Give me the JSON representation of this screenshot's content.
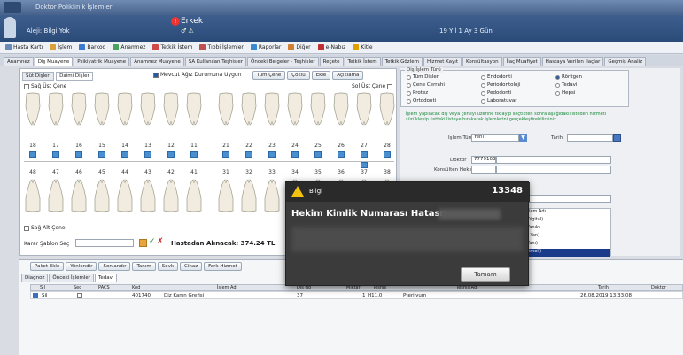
{
  "window": {
    "title": "Doktor Poliklinik İşlemleri"
  },
  "patient": {
    "name": "Erkek",
    "blood_group": "Aleji: Bilgi Yok",
    "age": "19 Yıl 1 Ay 3 Gün"
  },
  "menu": [
    "Hasta Kartı",
    "İşlem",
    "Barkod",
    "Anamnez",
    "Tetkik İstem",
    "Tıbbi İşlemler",
    "Raporlar",
    "Diğer",
    "e-Nabız",
    "Kitle"
  ],
  "menu_icon_colors": [
    "#6a8ab8",
    "#d9a13a",
    "#3a7ad0",
    "#4aa35a",
    "#d04a4a",
    "#c05050",
    "#3a8ad0",
    "#d08030",
    "#c03030",
    "#e0a000"
  ],
  "tabs": [
    "Anamnez",
    "Diş Muayene",
    "Psikiyatrik Muayene",
    "Anamnez Muayene",
    "SA Kullanılan Teşhisler",
    "Önceki Belgeler - Teşhisler",
    "Reçete",
    "Tetkik İstem",
    "Tetkik Gözlem",
    "Hizmet Kayıt",
    "Konsültasyon",
    "İlaç Muafiyet",
    "Hastaya Verilen İlaçlar",
    "Geçmiş Analiz"
  ],
  "left": {
    "subtabs": [
      "Süt Dişleri",
      "Daimi Dişler"
    ],
    "sag_ust": "Sağ Üst Çene",
    "sol_ust": "Sol Üst Çene",
    "mevcut": "Mevcut Ağız Durumuna Uygun",
    "btn_tum": "Tüm Çene",
    "btn_coklu": "Çoklu",
    "btn_ekle": "Ekle",
    "btn_aciklama": "Açıklama",
    "upper_nums": [
      "18",
      "17",
      "16",
      "15",
      "14",
      "13",
      "12",
      "11",
      "21",
      "22",
      "23",
      "24",
      "25",
      "26",
      "27",
      "28"
    ],
    "lower_nums": [
      "48",
      "47",
      "46",
      "45",
      "44",
      "43",
      "42",
      "41",
      "31",
      "32",
      "33",
      "34",
      "35",
      "36",
      "37",
      "38"
    ],
    "sag_alt": "Sağ Alt Çene",
    "karar": "Karar Şablon Seç",
    "hastadan": "Hastadan Alınacak: 374.24 TL"
  },
  "right": {
    "group_title": "Diş İşlem Türü",
    "radios": [
      {
        "label": "Tüm Dişler",
        "on": false
      },
      {
        "label": "Endodonti",
        "on": false
      },
      {
        "label": "Röntgen",
        "on": true
      },
      {
        "label": "Çene Cerrahi",
        "on": false
      },
      {
        "label": "Periodontoloji",
        "on": false
      },
      {
        "label": "Tedavi",
        "on": false
      },
      {
        "label": "Protez",
        "on": false
      },
      {
        "label": "Pedodonti",
        "on": false
      },
      {
        "label": "Hepsi",
        "on": false
      },
      {
        "label": "Ortodonti",
        "on": false
      },
      {
        "label": "Laboratuvar",
        "on": false
      }
    ],
    "info": "İşlem yapılacak diş veya çeneyi üzerine tıklayıp seçtikten sonra aşağıdaki listeden hizmeti sürükleyip üstteki listeye bırakarak işlemlerini gerçekleştirebilirsiniz",
    "islem_turu_label": "İşlem Türü",
    "islem_turu_value": "Yeni",
    "tarih_label": "Tarih",
    "doktor_label": "Doktor",
    "doktor_value": "7779103",
    "konsulten": "Konsülten Hekim",
    "list_items": [
      "İşlem Adı",
      "(Digital)",
      "(Yanık)",
      "(t Yan)",
      "(Yanı)",
      "(Ameli)"
    ]
  },
  "bottom": {
    "buttons": [
      "Paket Ekle",
      "Yönlendir",
      "Sonlandır",
      "Tanım",
      "Sevk",
      "Cihaz",
      "Fark Hizmet"
    ],
    "tabs": [
      "Diagnoz",
      "Önceki İşlemler",
      "Tedavi"
    ],
    "headers": [
      "Sıl",
      "Seç",
      "PACS",
      "Kod",
      "İşlem Adı",
      "Diş No",
      "Miktar",
      "Teşhis",
      "Teşhis Adı",
      "Tarih",
      "Doktor"
    ],
    "row": {
      "sil": "Sil",
      "kod": "401740",
      "islem": "Diz Kanın Grefisi",
      "disno": "37",
      "miktar": "1",
      "teshis": "H11.0",
      "teshis_adi": "Pterjiyum",
      "tarih": "26.08.2019 13:33:08"
    }
  },
  "modal": {
    "title": "Bilgi",
    "number": "13348",
    "message": "Hekim Kimlik Numarası Hatası:",
    "ok": "Tamam"
  }
}
